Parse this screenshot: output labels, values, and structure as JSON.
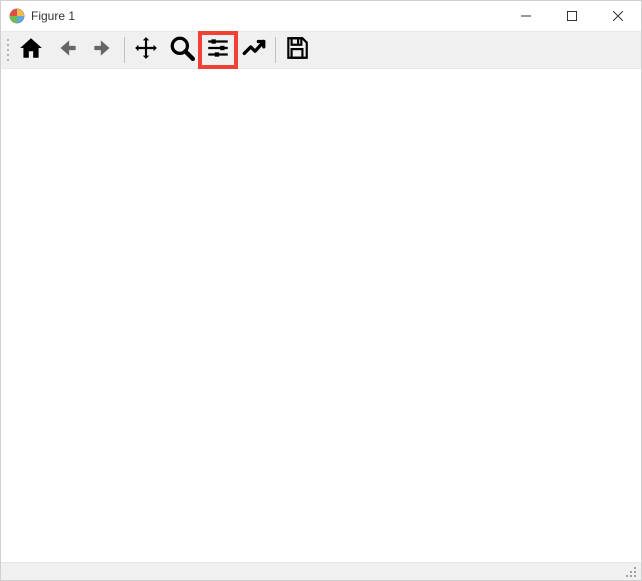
{
  "window": {
    "title": "Figure 1"
  },
  "toolbar": {
    "home_tooltip": "Reset original view",
    "back_tooltip": "Back to previous view",
    "forward_tooltip": "Forward to next view",
    "pan_tooltip": "Pan axes",
    "zoom_tooltip": "Zoom to rectangle",
    "subplots_tooltip": "Configure subplots",
    "edit_tooltip": "Edit axis, curve and image parameters",
    "save_tooltip": "Save the figure"
  },
  "highlight": {
    "target": "subplots",
    "color": "#ef4136"
  }
}
